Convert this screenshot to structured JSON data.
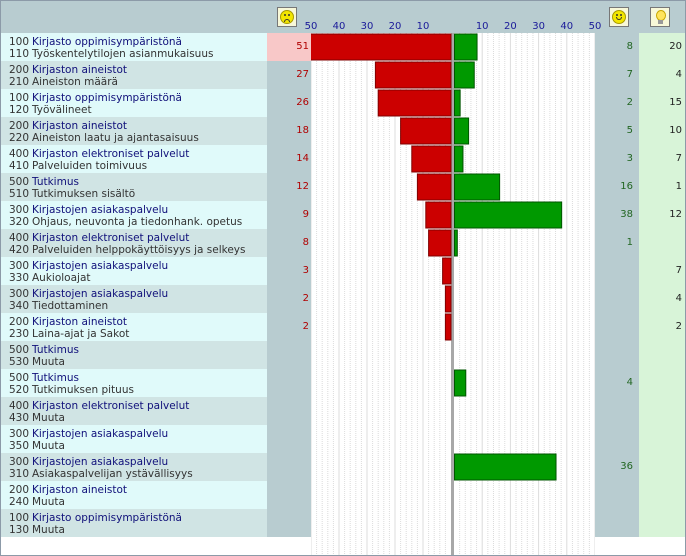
{
  "header": {
    "scale_left": [
      "50",
      "40",
      "30",
      "20",
      "10"
    ],
    "scale_right": [
      "10",
      "20",
      "30",
      "40",
      "50"
    ],
    "icons": [
      "sad-face-icon",
      "happy-face-icon",
      "light-bulb-icon"
    ]
  },
  "colors": {
    "negative": "#cc0000",
    "positive": "#009900",
    "row_a": "#e0fafa",
    "row_b": "#d0e4e4"
  },
  "chart_data": {
    "type": "bar",
    "orientation": "horizontal-diverging",
    "xlim_negative": [
      0,
      50
    ],
    "xlim_positive": [
      0,
      50
    ],
    "rows": [
      {
        "code1": "100",
        "cat": "Kirjasto oppimisympäristönä",
        "code2": "110",
        "sub": "Työskentelytilojen asianmukaisuus",
        "neg": 51,
        "pos": 8,
        "idea": 20
      },
      {
        "code1": "200",
        "cat": "Kirjaston aineistot",
        "code2": "210",
        "sub": "Aineiston määrä",
        "neg": 27,
        "pos": 7,
        "idea": 4
      },
      {
        "code1": "100",
        "cat": "Kirjasto oppimisympäristönä",
        "code2": "120",
        "sub": "Työvälineet",
        "neg": 26,
        "pos": 2,
        "idea": 15
      },
      {
        "code1": "200",
        "cat": "Kirjaston aineistot",
        "code2": "220",
        "sub": "Aineiston laatu ja ajantasaisuus",
        "neg": 18,
        "pos": 5,
        "idea": 10
      },
      {
        "code1": "400",
        "cat": "Kirjaston elektroniset palvelut",
        "code2": "410",
        "sub": "Palveluiden toimivuus",
        "neg": 14,
        "pos": 3,
        "idea": 7
      },
      {
        "code1": "500",
        "cat": "Tutkimus",
        "code2": "510",
        "sub": "Tutkimuksen sisältö",
        "neg": 12,
        "pos": 16,
        "idea": 1
      },
      {
        "code1": "300",
        "cat": "Kirjastojen asiakaspalvelu",
        "code2": "320",
        "sub": "Ohjaus, neuvonta ja tiedonhank. opetus",
        "neg": 9,
        "pos": 38,
        "idea": 12
      },
      {
        "code1": "400",
        "cat": "Kirjaston elektroniset palvelut",
        "code2": "420",
        "sub": "Palveluiden helppokäyttöisyys ja selkeys",
        "neg": 8,
        "pos": 1,
        "idea": null
      },
      {
        "code1": "300",
        "cat": "Kirjastojen asiakaspalvelu",
        "code2": "330",
        "sub": "Aukioloajat",
        "neg": 3,
        "pos": null,
        "idea": 7
      },
      {
        "code1": "300",
        "cat": "Kirjastojen asiakaspalvelu",
        "code2": "340",
        "sub": "Tiedottaminen",
        "neg": 2,
        "pos": null,
        "idea": 4
      },
      {
        "code1": "200",
        "cat": "Kirjaston aineistot",
        "code2": "230",
        "sub": "Laina-ajat ja Sakot",
        "neg": 2,
        "pos": null,
        "idea": 2
      },
      {
        "code1": "500",
        "cat": "Tutkimus",
        "code2": "530",
        "sub": "Muuta",
        "neg": null,
        "pos": null,
        "idea": null
      },
      {
        "code1": "500",
        "cat": "Tutkimus",
        "code2": "520",
        "sub": "Tutkimuksen pituus",
        "neg": null,
        "pos": 4,
        "idea": null
      },
      {
        "code1": "400",
        "cat": "Kirjaston elektroniset palvelut",
        "code2": "430",
        "sub": "Muuta",
        "neg": null,
        "pos": null,
        "idea": null
      },
      {
        "code1": "300",
        "cat": "Kirjastojen asiakaspalvelu",
        "code2": "350",
        "sub": "Muuta",
        "neg": null,
        "pos": null,
        "idea": null
      },
      {
        "code1": "300",
        "cat": "Kirjastojen asiakaspalvelu",
        "code2": "310",
        "sub": "Asiakaspalvelijan ystävällisyys",
        "neg": null,
        "pos": 36,
        "idea": null
      },
      {
        "code1": "200",
        "cat": "Kirjaston aineistot",
        "code2": "240",
        "sub": "Muuta",
        "neg": null,
        "pos": null,
        "idea": null
      },
      {
        "code1": "100",
        "cat": "Kirjasto oppimisympäristönä",
        "code2": "130",
        "sub": "Muuta",
        "neg": null,
        "pos": null,
        "idea": null
      }
    ]
  }
}
